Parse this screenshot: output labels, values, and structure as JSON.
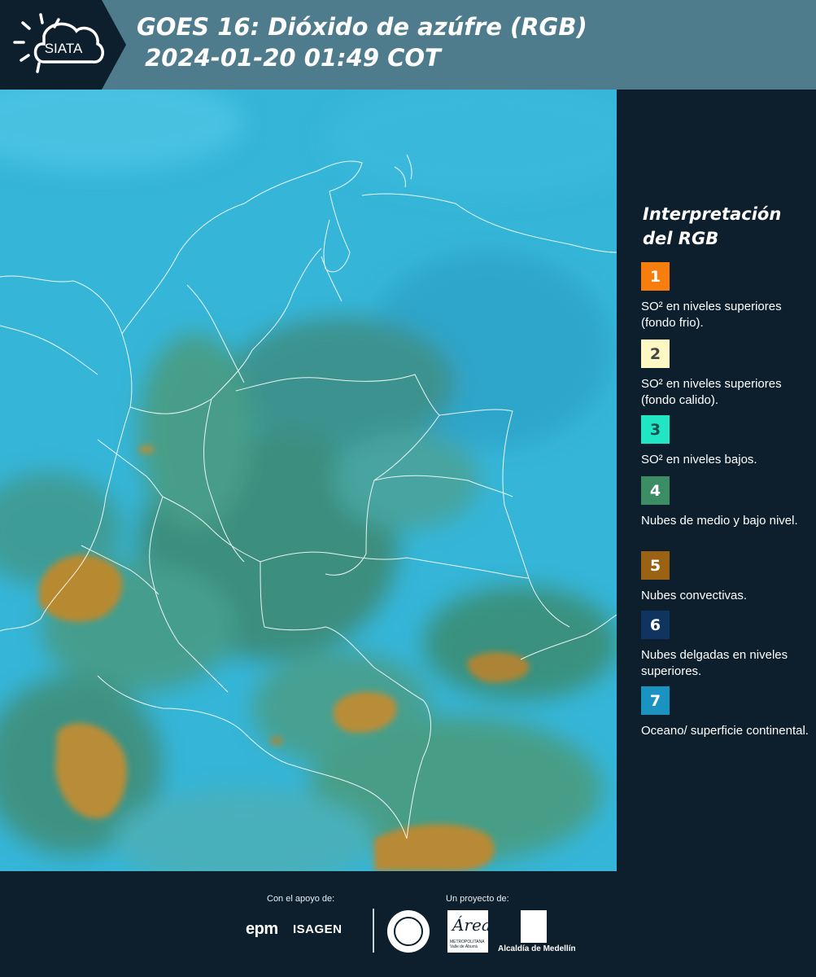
{
  "header": {
    "logo_text": "SIATA",
    "title": "GOES 16: Dióxido de azúfre (RGB)\n 2024-01-20 01:49 COT"
  },
  "legend": {
    "title": "Interpretación del RGB",
    "items": [
      {
        "number": "1",
        "color": "#f77d0c",
        "text_color": "#ffffff",
        "label": "SO² en niveles superiores (fondo frio)."
      },
      {
        "number": "2",
        "color": "#fdf7c4",
        "text_color": "#444444",
        "label": "SO² en niveles superiores (fondo calido)."
      },
      {
        "number": "3",
        "color": "#21e6c4",
        "text_color": "#1f4f4f",
        "label": "SO² en niveles bajos."
      },
      {
        "number": "4",
        "color": "#3c8c64",
        "text_color": "#ffffff",
        "label": "Nubes de medio y bajo nivel."
      },
      {
        "number": "5",
        "color": "#9a6212",
        "text_color": "#ffffff",
        "label": "Nubes convectivas."
      },
      {
        "number": "6",
        "color": "#0f3460",
        "text_color": "#ffffff",
        "label": "Nubes delgadas en niveles superiores."
      },
      {
        "number": "7",
        "color": "#1a93c0",
        "text_color": "#ffffff",
        "label": "Oceano/ superficie continental."
      }
    ]
  },
  "footer": {
    "support_label": "Con el apoyo de:",
    "project_label": "Un proyecto de:",
    "sponsor_1": "epm",
    "sponsor_2": "ISAGEN",
    "partner_area": "Área",
    "partner_area_sub": "METROPOLITANA Valle de Aburrá",
    "partner_alcaldia": "Alcaldía de Medellín"
  }
}
